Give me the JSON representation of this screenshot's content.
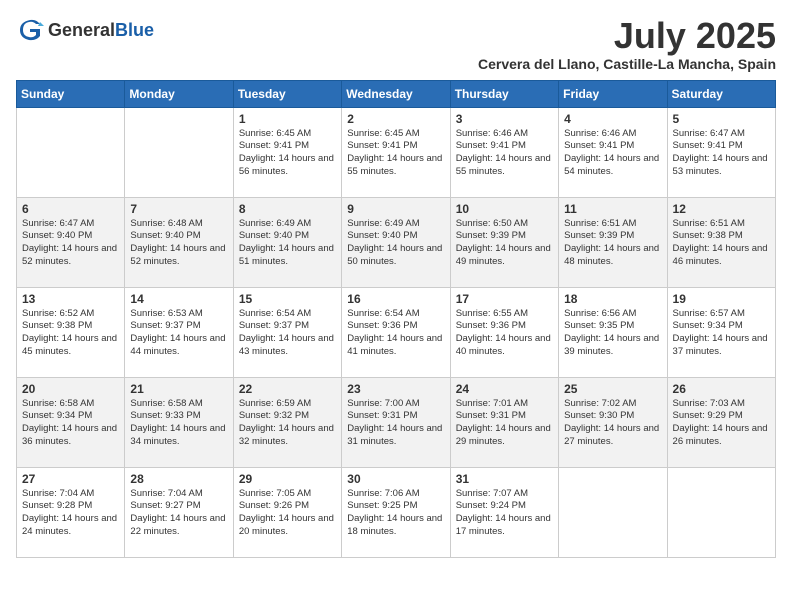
{
  "logo": {
    "general": "General",
    "blue": "Blue"
  },
  "title": {
    "month": "July 2025",
    "location": "Cervera del Llano, Castille-La Mancha, Spain"
  },
  "weekdays": [
    "Sunday",
    "Monday",
    "Tuesday",
    "Wednesday",
    "Thursday",
    "Friday",
    "Saturday"
  ],
  "weeks": [
    [
      {
        "day": "",
        "sunrise": "",
        "sunset": "",
        "daylight": ""
      },
      {
        "day": "",
        "sunrise": "",
        "sunset": "",
        "daylight": ""
      },
      {
        "day": "1",
        "sunrise": "Sunrise: 6:45 AM",
        "sunset": "Sunset: 9:41 PM",
        "daylight": "Daylight: 14 hours and 56 minutes."
      },
      {
        "day": "2",
        "sunrise": "Sunrise: 6:45 AM",
        "sunset": "Sunset: 9:41 PM",
        "daylight": "Daylight: 14 hours and 55 minutes."
      },
      {
        "day": "3",
        "sunrise": "Sunrise: 6:46 AM",
        "sunset": "Sunset: 9:41 PM",
        "daylight": "Daylight: 14 hours and 55 minutes."
      },
      {
        "day": "4",
        "sunrise": "Sunrise: 6:46 AM",
        "sunset": "Sunset: 9:41 PM",
        "daylight": "Daylight: 14 hours and 54 minutes."
      },
      {
        "day": "5",
        "sunrise": "Sunrise: 6:47 AM",
        "sunset": "Sunset: 9:41 PM",
        "daylight": "Daylight: 14 hours and 53 minutes."
      }
    ],
    [
      {
        "day": "6",
        "sunrise": "Sunrise: 6:47 AM",
        "sunset": "Sunset: 9:40 PM",
        "daylight": "Daylight: 14 hours and 52 minutes."
      },
      {
        "day": "7",
        "sunrise": "Sunrise: 6:48 AM",
        "sunset": "Sunset: 9:40 PM",
        "daylight": "Daylight: 14 hours and 52 minutes."
      },
      {
        "day": "8",
        "sunrise": "Sunrise: 6:49 AM",
        "sunset": "Sunset: 9:40 PM",
        "daylight": "Daylight: 14 hours and 51 minutes."
      },
      {
        "day": "9",
        "sunrise": "Sunrise: 6:49 AM",
        "sunset": "Sunset: 9:40 PM",
        "daylight": "Daylight: 14 hours and 50 minutes."
      },
      {
        "day": "10",
        "sunrise": "Sunrise: 6:50 AM",
        "sunset": "Sunset: 9:39 PM",
        "daylight": "Daylight: 14 hours and 49 minutes."
      },
      {
        "day": "11",
        "sunrise": "Sunrise: 6:51 AM",
        "sunset": "Sunset: 9:39 PM",
        "daylight": "Daylight: 14 hours and 48 minutes."
      },
      {
        "day": "12",
        "sunrise": "Sunrise: 6:51 AM",
        "sunset": "Sunset: 9:38 PM",
        "daylight": "Daylight: 14 hours and 46 minutes."
      }
    ],
    [
      {
        "day": "13",
        "sunrise": "Sunrise: 6:52 AM",
        "sunset": "Sunset: 9:38 PM",
        "daylight": "Daylight: 14 hours and 45 minutes."
      },
      {
        "day": "14",
        "sunrise": "Sunrise: 6:53 AM",
        "sunset": "Sunset: 9:37 PM",
        "daylight": "Daylight: 14 hours and 44 minutes."
      },
      {
        "day": "15",
        "sunrise": "Sunrise: 6:54 AM",
        "sunset": "Sunset: 9:37 PM",
        "daylight": "Daylight: 14 hours and 43 minutes."
      },
      {
        "day": "16",
        "sunrise": "Sunrise: 6:54 AM",
        "sunset": "Sunset: 9:36 PM",
        "daylight": "Daylight: 14 hours and 41 minutes."
      },
      {
        "day": "17",
        "sunrise": "Sunrise: 6:55 AM",
        "sunset": "Sunset: 9:36 PM",
        "daylight": "Daylight: 14 hours and 40 minutes."
      },
      {
        "day": "18",
        "sunrise": "Sunrise: 6:56 AM",
        "sunset": "Sunset: 9:35 PM",
        "daylight": "Daylight: 14 hours and 39 minutes."
      },
      {
        "day": "19",
        "sunrise": "Sunrise: 6:57 AM",
        "sunset": "Sunset: 9:34 PM",
        "daylight": "Daylight: 14 hours and 37 minutes."
      }
    ],
    [
      {
        "day": "20",
        "sunrise": "Sunrise: 6:58 AM",
        "sunset": "Sunset: 9:34 PM",
        "daylight": "Daylight: 14 hours and 36 minutes."
      },
      {
        "day": "21",
        "sunrise": "Sunrise: 6:58 AM",
        "sunset": "Sunset: 9:33 PM",
        "daylight": "Daylight: 14 hours and 34 minutes."
      },
      {
        "day": "22",
        "sunrise": "Sunrise: 6:59 AM",
        "sunset": "Sunset: 9:32 PM",
        "daylight": "Daylight: 14 hours and 32 minutes."
      },
      {
        "day": "23",
        "sunrise": "Sunrise: 7:00 AM",
        "sunset": "Sunset: 9:31 PM",
        "daylight": "Daylight: 14 hours and 31 minutes."
      },
      {
        "day": "24",
        "sunrise": "Sunrise: 7:01 AM",
        "sunset": "Sunset: 9:31 PM",
        "daylight": "Daylight: 14 hours and 29 minutes."
      },
      {
        "day": "25",
        "sunrise": "Sunrise: 7:02 AM",
        "sunset": "Sunset: 9:30 PM",
        "daylight": "Daylight: 14 hours and 27 minutes."
      },
      {
        "day": "26",
        "sunrise": "Sunrise: 7:03 AM",
        "sunset": "Sunset: 9:29 PM",
        "daylight": "Daylight: 14 hours and 26 minutes."
      }
    ],
    [
      {
        "day": "27",
        "sunrise": "Sunrise: 7:04 AM",
        "sunset": "Sunset: 9:28 PM",
        "daylight": "Daylight: 14 hours and 24 minutes."
      },
      {
        "day": "28",
        "sunrise": "Sunrise: 7:04 AM",
        "sunset": "Sunset: 9:27 PM",
        "daylight": "Daylight: 14 hours and 22 minutes."
      },
      {
        "day": "29",
        "sunrise": "Sunrise: 7:05 AM",
        "sunset": "Sunset: 9:26 PM",
        "daylight": "Daylight: 14 hours and 20 minutes."
      },
      {
        "day": "30",
        "sunrise": "Sunrise: 7:06 AM",
        "sunset": "Sunset: 9:25 PM",
        "daylight": "Daylight: 14 hours and 18 minutes."
      },
      {
        "day": "31",
        "sunrise": "Sunrise: 7:07 AM",
        "sunset": "Sunset: 9:24 PM",
        "daylight": "Daylight: 14 hours and 17 minutes."
      },
      {
        "day": "",
        "sunrise": "",
        "sunset": "",
        "daylight": ""
      },
      {
        "day": "",
        "sunrise": "",
        "sunset": "",
        "daylight": ""
      }
    ]
  ]
}
